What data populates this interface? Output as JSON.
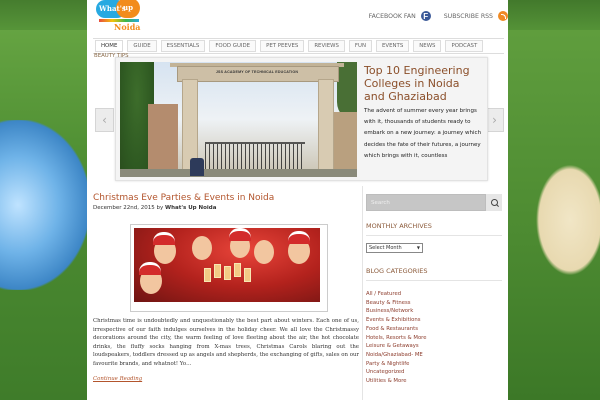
{
  "logo": {
    "word1": "What's",
    "word2": "up",
    "word3": "Noida"
  },
  "top_links": {
    "facebook": "FACEBOOK FAN",
    "rss": "SUBSCRIBE RSS"
  },
  "nav": {
    "items": [
      "HOME",
      "GUIDE",
      "ESSENTIALS",
      "FOOD GUIDE",
      "PET PEEVES",
      "REVIEWS",
      "FUN",
      "EVENTS",
      "NEWS",
      "PODCAST"
    ],
    "sub": "BEAUTY TIPS"
  },
  "slider": {
    "gate_text": "JSS ACADEMY OF TECHNICAL EDUCATION",
    "title": "Top 10 Engineering Colleges in Noida and Ghaziabad",
    "excerpt": "The advent of summer every year brings with it, thousands of students ready to embark on a new journey: a journey which decides the fate of their futures, a journey which brings with it, countless",
    "prev": "‹",
    "next": "›"
  },
  "post": {
    "title": "Christmas Eve Parties & Events in Noida",
    "date": "December 22nd, 2015",
    "by": "by",
    "author": "What's Up Noida",
    "body": "Christmas time is undoubtedly and unquestionably the best part about winters. Each one of us, irrespective of our faith indulges ourselves in the holiday cheer.  We all love the Christmassy decorations around the city, the warm feeling of love fleeting about the air, the hot chocolate drinks, the fluffy socks hanging from X-mas trees, Christmas Carols blaring out the loudspeakers, toddlers dressed up as angels and shepherds, the exchanging of gifts, sales on our favourite brands, and whatnot! Yo…",
    "continue": "Continue Reading"
  },
  "sidebar": {
    "search_placeholder": "Search",
    "archives_title": "MONTHLY ARCHIVES",
    "archives_select": "Select Month",
    "categories_title": "BLOG CATEGORIES",
    "categories": [
      "All / Featured",
      "Beauty & Fitness",
      "Business/Network",
      "Events & Exhibitions",
      "Food & Restaurants",
      "Hotels, Resorts & More",
      "Leisure & Getaways",
      "Noida/Ghaziabad- ME",
      "Party & Nightlife",
      "Uncategorized",
      "Utilities & More"
    ]
  }
}
